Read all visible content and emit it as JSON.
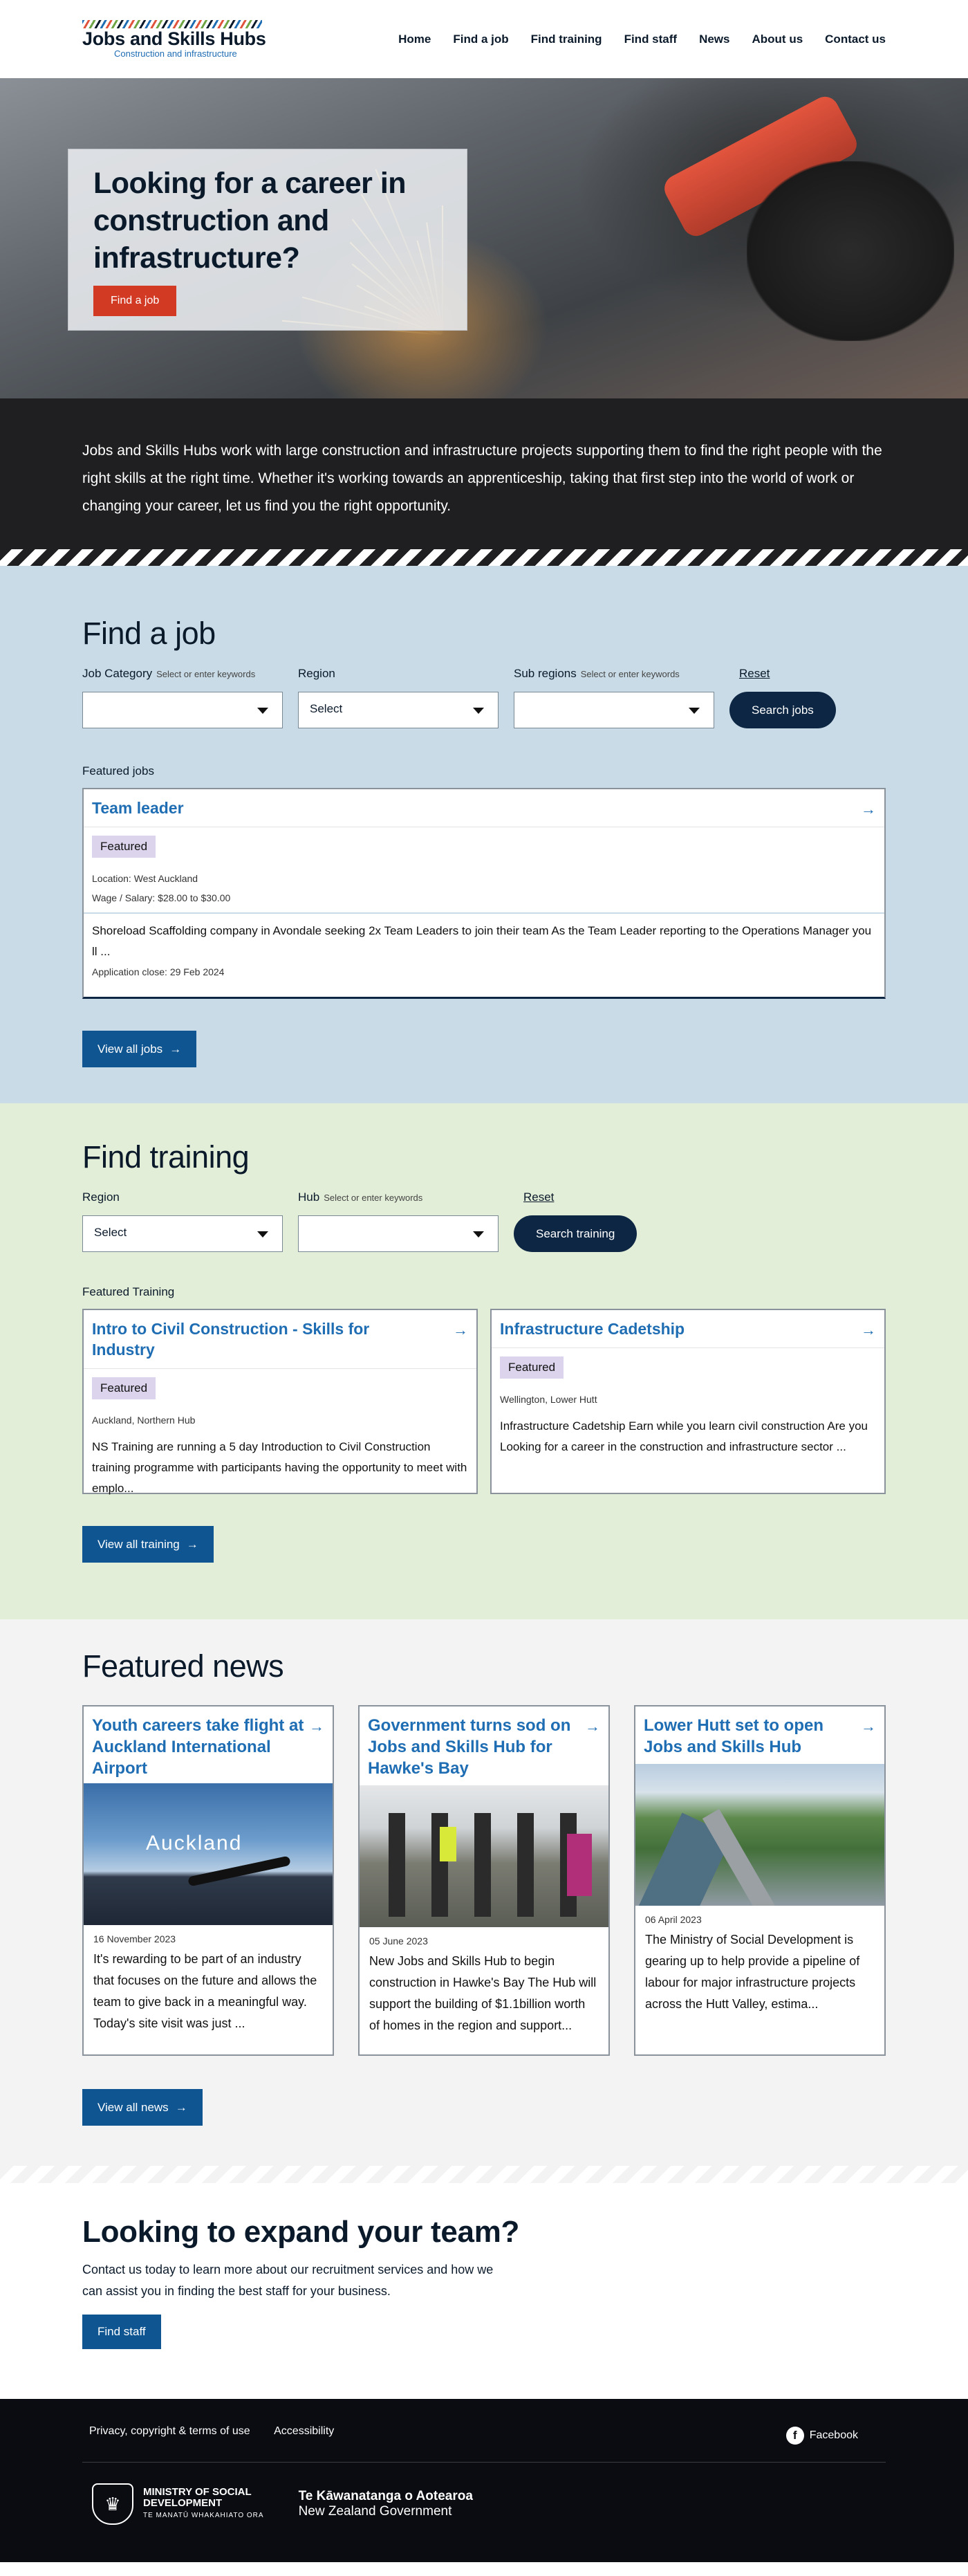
{
  "header": {
    "logo_title": "Jobs and Skills Hubs",
    "logo_subtitle": "Construction and infrastructure",
    "nav": [
      "Home",
      "Find a job",
      "Find training",
      "Find staff",
      "News",
      "About us",
      "Contact us"
    ]
  },
  "hero": {
    "title": "Looking for a career in construction and infrastructure?",
    "button": "Find a job"
  },
  "intro": {
    "text": "Jobs and Skills Hubs work with large construction and infrastructure projects supporting them to find the right people with the right skills at the right time. Whether it's working towards an apprenticeship, taking that first step into the world of work or changing your career, let us find you the right opportunity."
  },
  "jobs": {
    "title": "Find a job",
    "filters": {
      "category_label": "Job Category",
      "category_hint": "Select or enter keywords",
      "category_value": "",
      "region_label": "Region",
      "region_value": "Select",
      "subregion_label": "Sub regions",
      "subregion_hint": "Select or enter keywords",
      "subregion_value": "",
      "reset": "Reset",
      "search": "Search jobs"
    },
    "featured_label": "Featured jobs",
    "featured": {
      "title": "Team leader",
      "badge": "Featured",
      "location": "Location: West Auckland",
      "wage": "Wage / Salary: $28.00 to $30.00",
      "description": "Shoreload Scaffolding company in Avondale seeking 2x Team Leaders to join their team As the Team Leader reporting to the Operations Manager you ll ...",
      "closes": "Application close: 29 Feb 2024"
    },
    "view_all": "View all jobs"
  },
  "training": {
    "title": "Find training",
    "filters": {
      "region_label": "Region",
      "region_value": "Select",
      "hub_label": "Hub",
      "hub_hint": "Select or enter keywords",
      "hub_value": "",
      "reset": "Reset",
      "search": "Search training"
    },
    "featured_label": "Featured Training",
    "cards": [
      {
        "title": "Intro to Civil Construction - Skills for Industry",
        "badge": "Featured",
        "location": "Auckland, Northern Hub",
        "description": "NS Training are running a 5 day Introduction to Civil Construction training programme with participants having the opportunity to meet with emplo..."
      },
      {
        "title": "Infrastructure Cadetship",
        "badge": "Featured",
        "location": "Wellington, Lower Hutt",
        "description": "Infrastructure Cadetship Earn while you learn civil construction Are you Looking for a career in the construction and infrastructure sector ..."
      }
    ],
    "view_all": "View all training"
  },
  "news": {
    "title": "Featured news",
    "cards": [
      {
        "title": "Youth careers take flight at Auckland International Airport",
        "image_text": "Auckland",
        "date": "16 November 2023",
        "description": "It's rewarding to be part of an industry that focuses on the future and allows the team to give back in a meaningful way. Today's site visit was just ..."
      },
      {
        "title": "Government turns sod on Jobs and Skills Hub for Hawke's Bay",
        "image_text": "",
        "date": "05 June 2023",
        "description": "New Jobs and Skills Hub to begin construction in Hawke's Bay The Hub will support the building of $1.1billion worth of homes in the region and support..."
      },
      {
        "title": "Lower Hutt set to open Jobs and Skills Hub",
        "image_text": "",
        "date": "06 April 2023",
        "description": "The Ministry of Social Development is gearing up to help provide a pipeline of labour for major infrastructure projects across the Hutt Valley, estima..."
      }
    ],
    "view_all": "View all news"
  },
  "expand": {
    "title": "Looking to expand your team?",
    "text": "Contact us today to learn more about our recruitment services and how we can assist you in finding the best staff for your business.",
    "button": "Find staff"
  },
  "footer": {
    "links": [
      "Privacy, copyright & terms of use",
      "Accessibility"
    ],
    "facebook": "Facebook",
    "msd_line1": "MINISTRY OF SOCIAL",
    "msd_line2": "DEVELOPMENT",
    "msd_maori": "TE MANATŪ WHAKAHIATO ORA",
    "nzg_maori": "Te Kāwanatanga o Aotearoa",
    "nzg_english": "New Zealand Government"
  },
  "colors": {
    "navy": "#0c2644",
    "link_blue": "#1f6db3",
    "button_blue": "#0f5592",
    "red": "#d23a24",
    "jobs_bg": "#c9dbe6",
    "training_bg": "#e3eed8",
    "news_bg": "#f3f3f3",
    "badge_bg": "#dcd4ec"
  },
  "icons": [
    "arrow-right-icon",
    "chevron-down-icon",
    "facebook-icon",
    "nz-crest-icon"
  ]
}
